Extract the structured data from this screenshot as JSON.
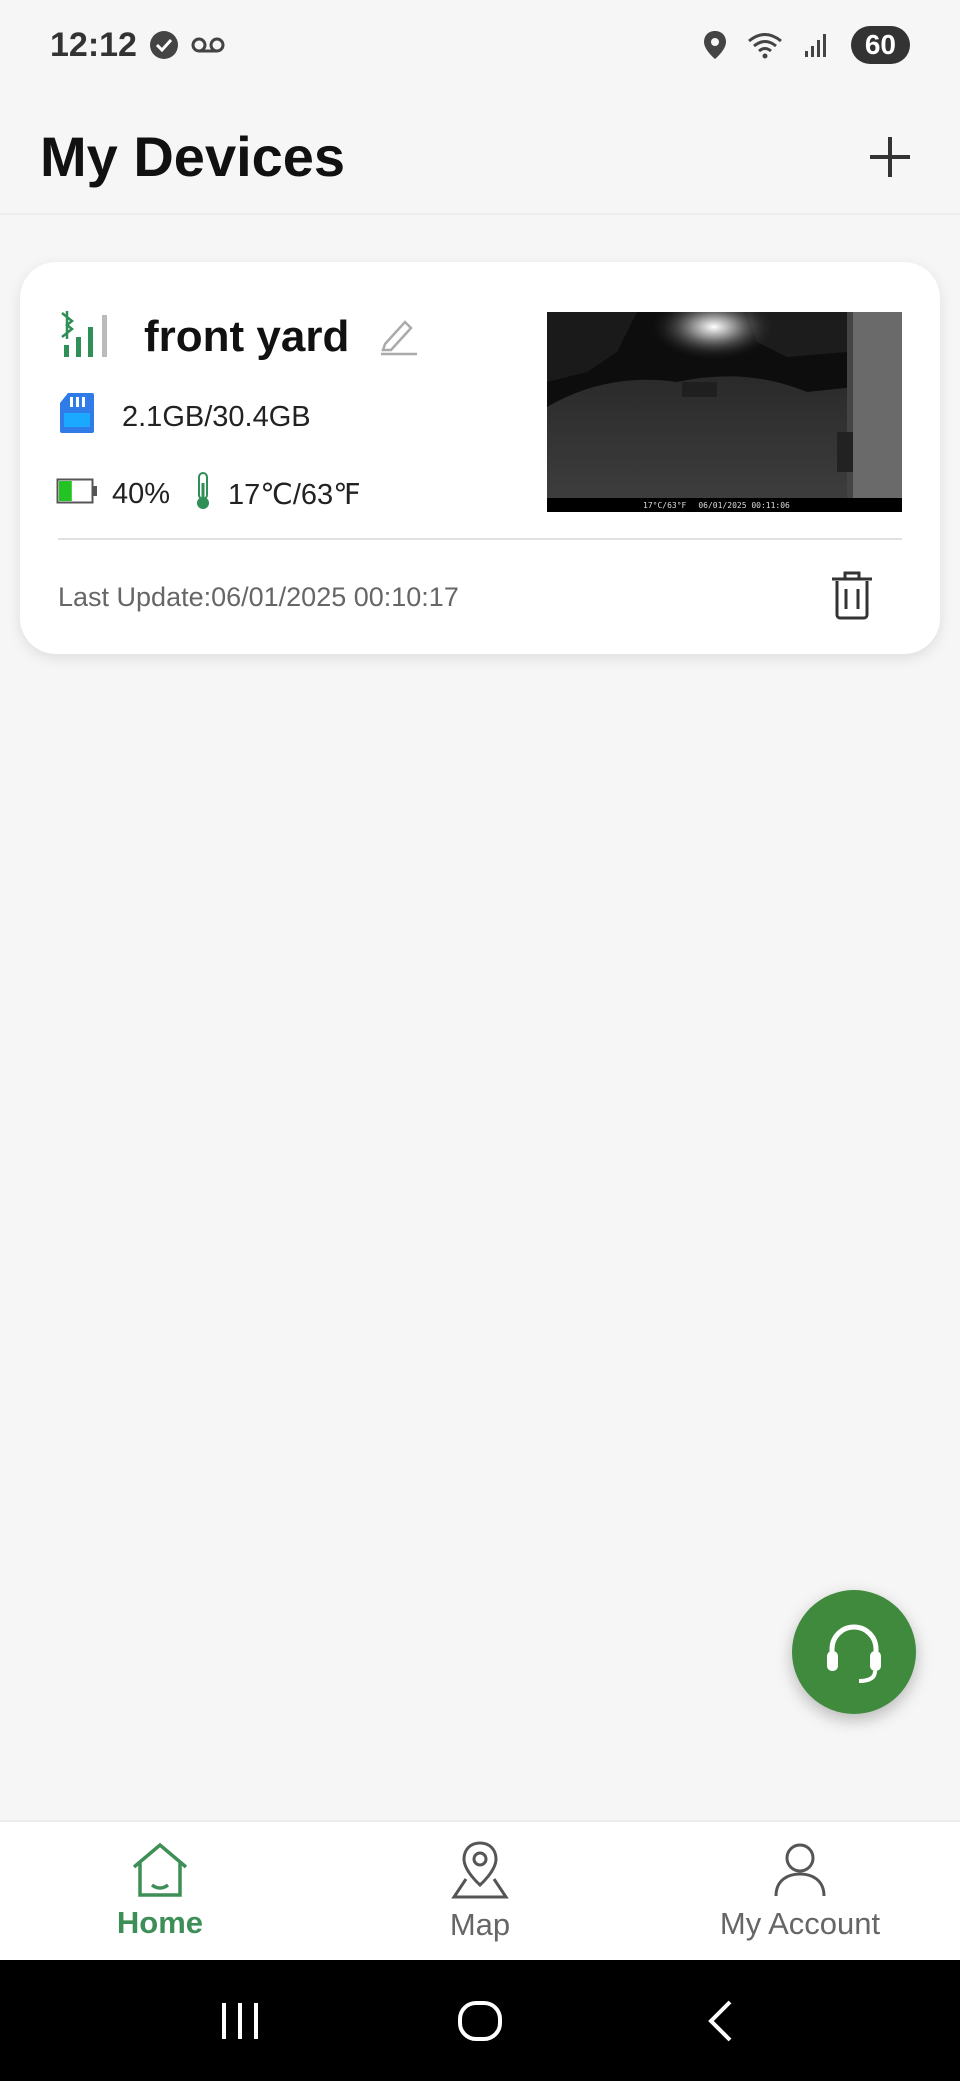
{
  "status_bar": {
    "time": "12:12",
    "battery_level": "60"
  },
  "header": {
    "title": "My Devices"
  },
  "device": {
    "name": "front yard",
    "storage": "2.1GB/30.4GB",
    "battery": "40%",
    "battery_fill": 0.4,
    "temperature": "17℃/63℉",
    "last_update": "Last Update:06/01/2025 00:10:17",
    "thumbnail_overlay": {
      "temp": "17°C/63°F",
      "datetime": "06/01/2025 00:11:06"
    }
  },
  "nav": {
    "items": [
      {
        "label": "Home",
        "icon": "home-icon",
        "active": true
      },
      {
        "label": "Map",
        "icon": "map-pin-icon",
        "active": false
      },
      {
        "label": "My Account",
        "icon": "account-icon",
        "active": false
      }
    ]
  },
  "colors": {
    "accent": "#3e8e57",
    "fab": "#3f8a3c",
    "sd_card": "#2f7be8",
    "battery_fill": "#22c322"
  }
}
